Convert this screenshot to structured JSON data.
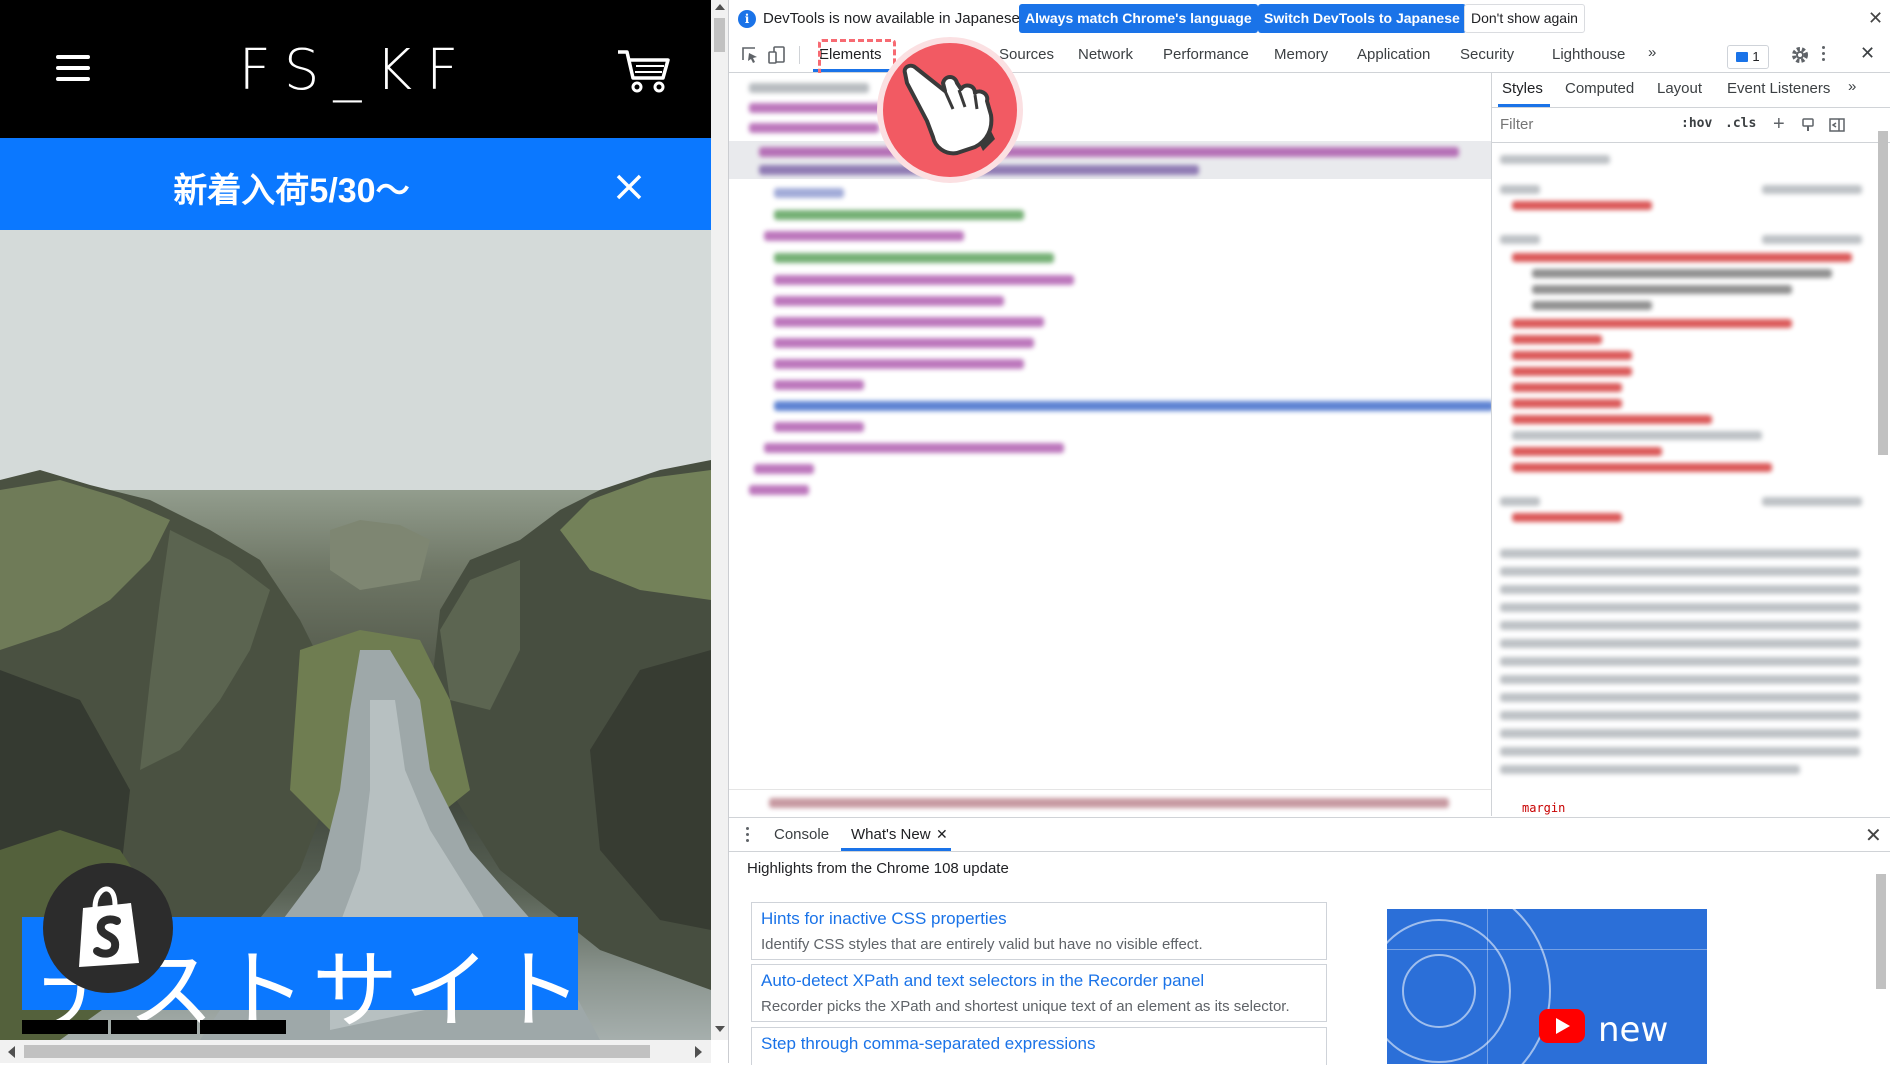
{
  "site": {
    "logo": "FS_KF",
    "announcement": "新着入荷5/30〜",
    "hero_title": "テストサイト"
  },
  "devtools": {
    "infobar": {
      "message": "DevTools is now available in Japanese!",
      "btn_match": "Always match Chrome's language",
      "btn_switch": "Switch DevTools to Japanese",
      "btn_dont_show": "Don't show again"
    },
    "tabs": [
      "Elements",
      "Sources",
      "Network",
      "Performance",
      "Memory",
      "Application",
      "Security",
      "Lighthouse"
    ],
    "active_tab": "Elements",
    "issues_count": "1",
    "styles_tabs": [
      "Styles",
      "Computed",
      "Layout",
      "Event Listeners"
    ],
    "filter_placeholder": "Filter",
    "hov": ":hov",
    "cls": ".cls",
    "margin_label": "margin",
    "drawer": {
      "tabs": [
        "Console",
        "What's New"
      ],
      "headline": "Highlights from the Chrome 108 update",
      "cards": [
        {
          "title": "Hints for inactive CSS properties",
          "desc": "Identify CSS styles that are entirely valid but have no visible effect."
        },
        {
          "title": "Auto-detect XPath and text selectors in the Recorder panel",
          "desc": "Recorder picks the XPath and shortest unique text of an element as its selector."
        },
        {
          "title": "Step through comma-separated expressions",
          "desc": ""
        }
      ],
      "video_label": "new"
    }
  },
  "colors": {
    "accent_blue": "#1a73e8",
    "site_blue": "#0b78ff",
    "pointer_red": "#f25a63"
  }
}
